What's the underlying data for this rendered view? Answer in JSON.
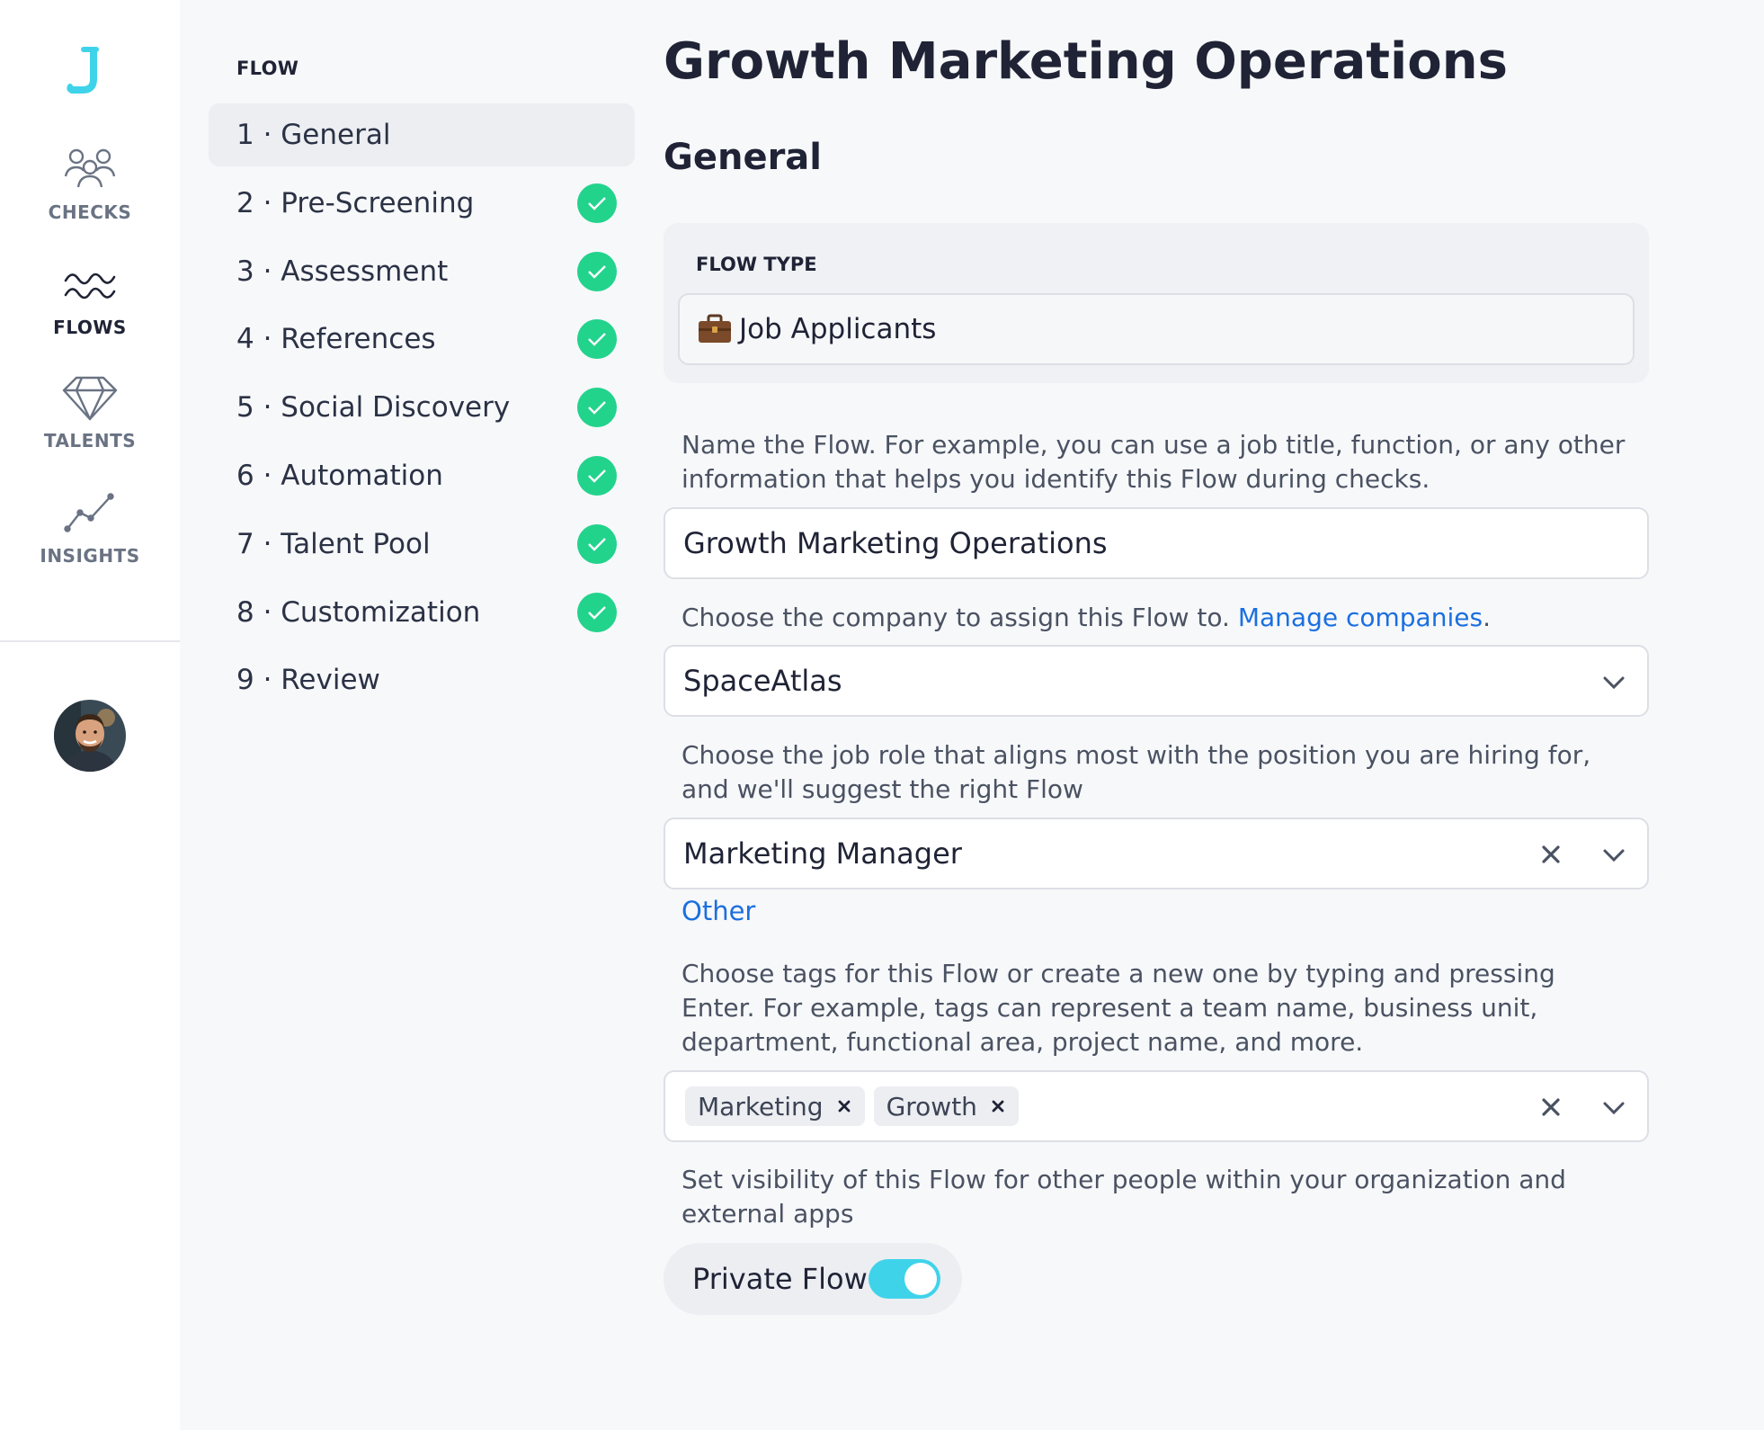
{
  "rail": {
    "items": [
      {
        "label": "CHECKS",
        "icon": "people-icon"
      },
      {
        "label": "FLOWS",
        "icon": "waves-icon"
      },
      {
        "label": "TALENTS",
        "icon": "diamond-icon"
      },
      {
        "label": "INSIGHTS",
        "icon": "line-chart-icon"
      }
    ],
    "active": "FLOWS"
  },
  "steps": {
    "heading": "FLOW",
    "items": [
      {
        "label": "1 · General",
        "completed": false,
        "active": true
      },
      {
        "label": "2 · Pre-Screening",
        "completed": true
      },
      {
        "label": "3 · Assessment",
        "completed": true
      },
      {
        "label": "4 · References",
        "completed": true
      },
      {
        "label": "5 · Social Discovery",
        "completed": true
      },
      {
        "label": "6 · Automation",
        "completed": true
      },
      {
        "label": "7 · Talent Pool",
        "completed": true
      },
      {
        "label": "8 · Customization",
        "completed": true
      },
      {
        "label": "9 · Review",
        "completed": false
      }
    ]
  },
  "main": {
    "title": "Growth Marketing Operations",
    "section": "General",
    "flow_type": {
      "label": "FLOW TYPE",
      "value": "Job Applicants",
      "icon": "briefcase-icon"
    },
    "name": {
      "help": "Name the Flow. For example, you can use a job title, function, or any other information that helps you identify this Flow during checks.",
      "value": "Growth Marketing Operations"
    },
    "company": {
      "help_prefix": "Choose the company to assign this Flow to.",
      "help_link": "Manage companies",
      "help_suffix": ".",
      "value": "SpaceAtlas"
    },
    "job_role": {
      "help": "Choose the job role that aligns most with the position you are hiring for, and we'll suggest the right Flow",
      "value": "Marketing Manager",
      "other_link": "Other"
    },
    "tags": {
      "help": "Choose tags for this Flow or create a new one by typing and pressing Enter. For example, tags can represent a team name, business unit, department, functional area, project name, and more.",
      "items": [
        "Marketing",
        "Growth"
      ]
    },
    "visibility": {
      "help": "Set visibility of this Flow for other people within your organization and external apps",
      "toggle_label": "Private Flow",
      "enabled": true
    }
  },
  "colors": {
    "accent_link": "#1a6fe0",
    "check_green": "#22d38c",
    "toggle_on": "#3fd3ea",
    "logo_cyan": "#3fd3ea"
  }
}
